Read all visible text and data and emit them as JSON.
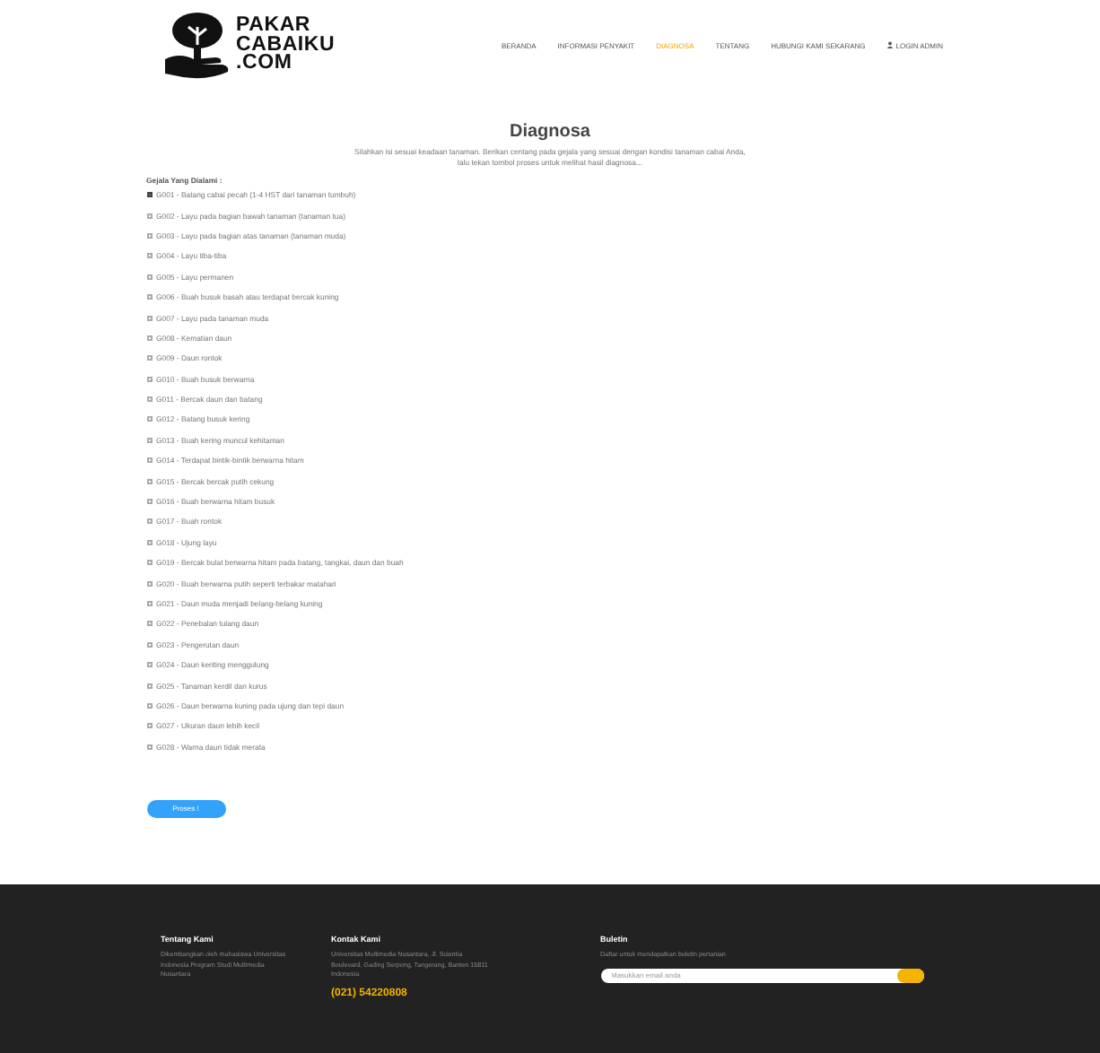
{
  "logo": {
    "lines": [
      "PAKAR",
      "CABAIKU",
      ".COM"
    ]
  },
  "nav": [
    {
      "label": "BERANDA",
      "selected": false
    },
    {
      "label": "INFORMASI PENYAKIT",
      "selected": false
    },
    {
      "label": "DIAGNOSA",
      "selected": true
    },
    {
      "label": "TENTANG",
      "selected": false
    },
    {
      "label": "HUBUNGI KAMI SEKARANG",
      "selected": false
    },
    {
      "label": "LOGIN ADMIN",
      "selected": false,
      "kind": "user"
    }
  ],
  "title": "Diagnosa",
  "description": "Silahkan isi sesuai keadaan tanaman. Berikan centang pada gejala yang sesuai dengan kondisi tanaman cabai Anda, lalu tekan tombol proses untuk melihat hasil diagnosa...",
  "symptoms_label": "Gejala Yang Dialami :",
  "symptoms": [
    {
      "label": "G001 - Batang cabai pecah (1-4 HST dari tanaman tumbuh)",
      "checked": true
    },
    {
      "label": "G002 - Layu pada bagian bawah tanaman (tanaman tua)",
      "checked": false
    },
    {
      "label": "G003 - Layu pada bagian atas tanaman (tanaman muda)",
      "checked": false
    },
    {
      "label": "G004 - Layu tiba-tiba",
      "checked": false
    },
    {
      "label": "G005 - Layu permanen",
      "checked": false
    },
    {
      "label": "G006 - Buah busuk basah atau terdapat bercak kuning",
      "checked": false
    },
    {
      "label": "G007 - Layu pada tanaman muda",
      "checked": false
    },
    {
      "label": "G008 - Kematian daun",
      "checked": false
    },
    {
      "label": "G009 - Daun rontok",
      "checked": false
    },
    {
      "label": "G010 - Buah busuk berwarna",
      "checked": false
    },
    {
      "label": "G011 - Bercak daun dan batang",
      "checked": false
    },
    {
      "label": "G012 - Batang busuk kering",
      "checked": false
    },
    {
      "label": "G013 - Buah kering muncul kehitaman",
      "checked": false
    },
    {
      "label": "G014 - Terdapat bintik-bintik berwarna hitam",
      "checked": false
    },
    {
      "label": "G015 - Bercak bercak putih cekung",
      "checked": false
    },
    {
      "label": "G016 - Buah berwarna hitam busuk",
      "checked": false
    },
    {
      "label": "G017 - Buah rontok",
      "checked": false
    },
    {
      "label": "G018 - Ujung layu",
      "checked": false
    },
    {
      "label": "G019 - Bercak bulat berwarna hitam pada batang, tangkai, daun dan buah",
      "checked": false
    },
    {
      "label": "G020 - Buah berwarna putih seperti terbakar matahari",
      "checked": false
    },
    {
      "label": "G021 - Daun muda menjadi belang-belang kuning",
      "checked": false
    },
    {
      "label": "G022 - Penebalan tulang daun",
      "checked": false
    },
    {
      "label": "G023 - Pengerutan daun",
      "checked": false
    },
    {
      "label": "G024 - Daun keriting menggulung",
      "checked": false
    },
    {
      "label": "G025 - Tanaman kerdil dan kurus",
      "checked": false
    },
    {
      "label": "G026 - Daun berwarna kuning pada ujung dan tepi daun",
      "checked": false
    },
    {
      "label": "G027 - Ukuran daun lebih kecil",
      "checked": false
    },
    {
      "label": "G028 - Warna daun tidak merata",
      "checked": false
    }
  ],
  "submit": "Proses !",
  "footer": {
    "columns": [
      {
        "heading": "Tentang Kami",
        "text": "Dikembangkan oleh mahasiswa Universitas Indonesia Program Studi Multimedia Nusantara"
      },
      {
        "heading": "Kontak Kami",
        "text": "Universitas Multimedia Nusantara, Jl. Scientia Boulevard, Gading Serpong, Tangerang, Banten 15811 Indonesia",
        "phone": "(021) 54220808"
      },
      {
        "heading": "Buletin",
        "text": "Daftar untuk mendapatkan buletin pertanian",
        "placeholder": "Masukkan email anda"
      }
    ]
  }
}
